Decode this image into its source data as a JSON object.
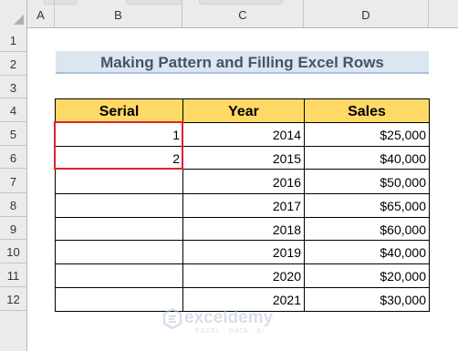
{
  "columns": [
    "A",
    "B",
    "C",
    "D"
  ],
  "rows": [
    "1",
    "2",
    "3",
    "4",
    "5",
    "6",
    "7",
    "8",
    "9",
    "10",
    "11",
    "12"
  ],
  "title": "Making Pattern and Filling Excel Rows",
  "table": {
    "headers": [
      "Serial",
      "Year",
      "Sales"
    ],
    "rows": [
      {
        "serial": "1",
        "year": "2014",
        "sales": "$25,000"
      },
      {
        "serial": "2",
        "year": "2015",
        "sales": "$40,000"
      },
      {
        "serial": "",
        "year": "2016",
        "sales": "$50,000"
      },
      {
        "serial": "",
        "year": "2017",
        "sales": "$65,000"
      },
      {
        "serial": "",
        "year": "2018",
        "sales": "$60,000"
      },
      {
        "serial": "",
        "year": "2019",
        "sales": "$40,000"
      },
      {
        "serial": "",
        "year": "2020",
        "sales": "$20,000"
      },
      {
        "serial": "",
        "year": "2021",
        "sales": "$30,000"
      }
    ]
  },
  "selection_color": "#e0202a",
  "header_fill": "#ffd966",
  "watermark": {
    "name": "exceldemy",
    "tagline": "EXCEL · DATA · BI",
    "icon": "exceldemy-logo-icon"
  }
}
